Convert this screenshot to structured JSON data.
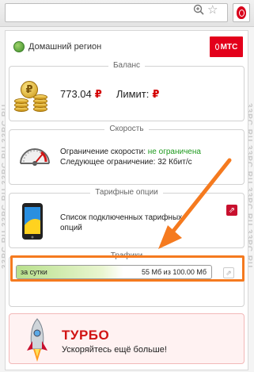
{
  "watermark": "33PC.RU",
  "browser": {
    "zoom_icon": "magnifier-plus-icon",
    "star_icon": "star-icon",
    "extension_icon": "mts-egg-icon"
  },
  "header": {
    "region_label": "Домашний регион",
    "region_icon": "globe-icon",
    "brand": "МТС"
  },
  "balance": {
    "title": "Баланс",
    "amount": "773.04",
    "currency": "₽",
    "limit_label": "Лимит:",
    "limit_currency": "₽"
  },
  "speed": {
    "title": "Скорость",
    "limit_label": "Ограничение скорости:",
    "limit_value": "не ограничена",
    "next_label": "Следующее ограничение:",
    "next_value": "32 Кбит/с"
  },
  "tariff": {
    "title": "Тарифные опции",
    "description": "Список подключенных тарифных опций"
  },
  "traffic": {
    "title": "Трафики",
    "period_label": "за сутки",
    "amount": "55 Мб из 100.00 Мб",
    "used_fraction": 0.55
  },
  "turbo": {
    "title": "ТУРБО",
    "subtitle": "Ускоряйтесь ещё больше!"
  },
  "colors": {
    "accent_red": "#e3001b",
    "highlight_orange": "#f57a1f",
    "ok_green": "#1f9a1f"
  }
}
